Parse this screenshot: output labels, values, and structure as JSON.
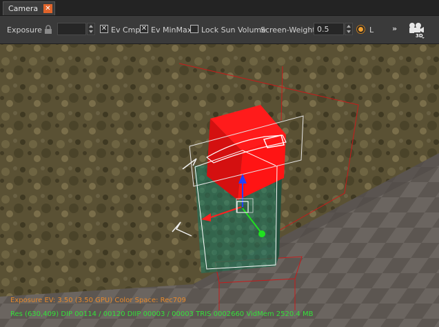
{
  "tab": {
    "label": "Camera",
    "close_glyph": "✕"
  },
  "toolbar": {
    "exposure_label": "Exposure",
    "exposure_value": "",
    "ev_cmp_label": "Ev Cmp",
    "ev_cmp_checked": true,
    "ev_minmax_label": "Ev MinMax",
    "ev_minmax_checked": true,
    "lock_sun_label": "Lock Sun Volume",
    "lock_sun_checked": false,
    "screen_weight_label": "Screen-Weight",
    "screen_weight_value": "0.5",
    "radio_label": "L",
    "more_glyph": "»",
    "view_mode_badge": "3D",
    "check_glyph": "✕"
  },
  "hud": {
    "line1": "Exposure EV: 3.50 (3.50 GPU)  Color Space: Rec709",
    "line2": "Res (630,409)  DIP 00114 / 00120  DIIP 00003 / 00003  TRIS 0002660  VidMem 2520.4 MB"
  },
  "colors": {
    "accent": "#e0642b",
    "hud_orange": "#e88a2c",
    "hud_green": "#34e03a",
    "selection_red": "#ff1414",
    "gizmo_x": "#ff2020",
    "gizmo_y": "#2040ff",
    "gizmo_z": "#20e020"
  },
  "icons": {
    "lock": "lock-icon",
    "camera": "camera-icon",
    "close": "close-icon"
  }
}
